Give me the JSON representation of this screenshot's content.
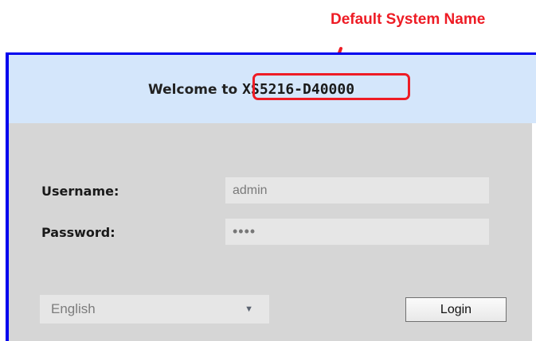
{
  "annotation": {
    "label": "Default System Name",
    "color": "#ee1c25"
  },
  "welcome": {
    "prefix": "Welcome to",
    "system_name": "XS5216-D40000"
  },
  "form": {
    "username_label": "Username:",
    "username_value": "admin",
    "password_label": "Password:",
    "password_masked": "••••"
  },
  "language": {
    "selected": "English",
    "caret": "▼"
  },
  "login_button": {
    "label": "Login"
  },
  "colors": {
    "frame_border": "#0000ee",
    "welcome_bg": "#d4e6fb",
    "panel_bg": "#d6d6d6",
    "input_bg": "#e6e6e6"
  }
}
